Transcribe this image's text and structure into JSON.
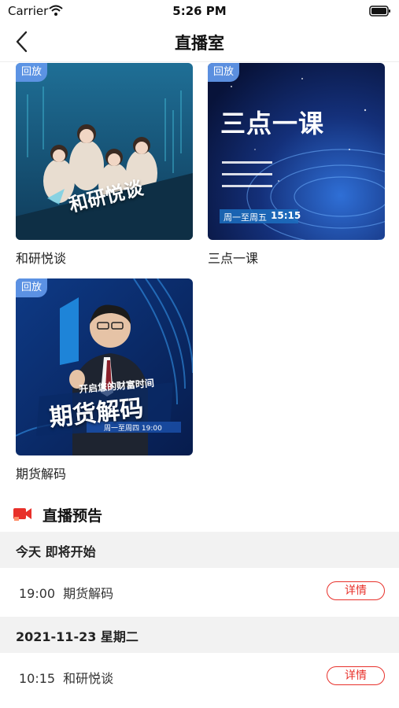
{
  "status_bar": {
    "carrier": "Carrier",
    "time": "5:26 PM"
  },
  "nav": {
    "title": "直播室"
  },
  "cards": [
    {
      "tag": "回放",
      "label": "和研悦谈",
      "overlay_title": "和研悦谈"
    },
    {
      "tag": "回放",
      "label": "三点一课",
      "overlay_title": "三点一课",
      "overlay_schedule": "周一至周五",
      "overlay_time": "15:15"
    },
    {
      "tag": "回放",
      "label": "期货解码",
      "overlay_title": "期货解码",
      "overlay_slogan": "开启您的财富时间",
      "overlay_schedule": "周一至周四 19:00"
    }
  ],
  "preview_section": {
    "title": "直播预告"
  },
  "schedule": [
    {
      "day": "今天 即将开始",
      "items": [
        {
          "time": "19:00",
          "name": "期货解码",
          "action": "详情"
        }
      ]
    },
    {
      "day": "2021-11-23 星期二",
      "items": [
        {
          "time": "10:15",
          "name": "和研悦谈",
          "action": "详情"
        }
      ]
    }
  ],
  "colors": {
    "accent": "#e8302a",
    "tag_bg": "#6096e8",
    "day_header_bg": "#f2f2f2"
  }
}
